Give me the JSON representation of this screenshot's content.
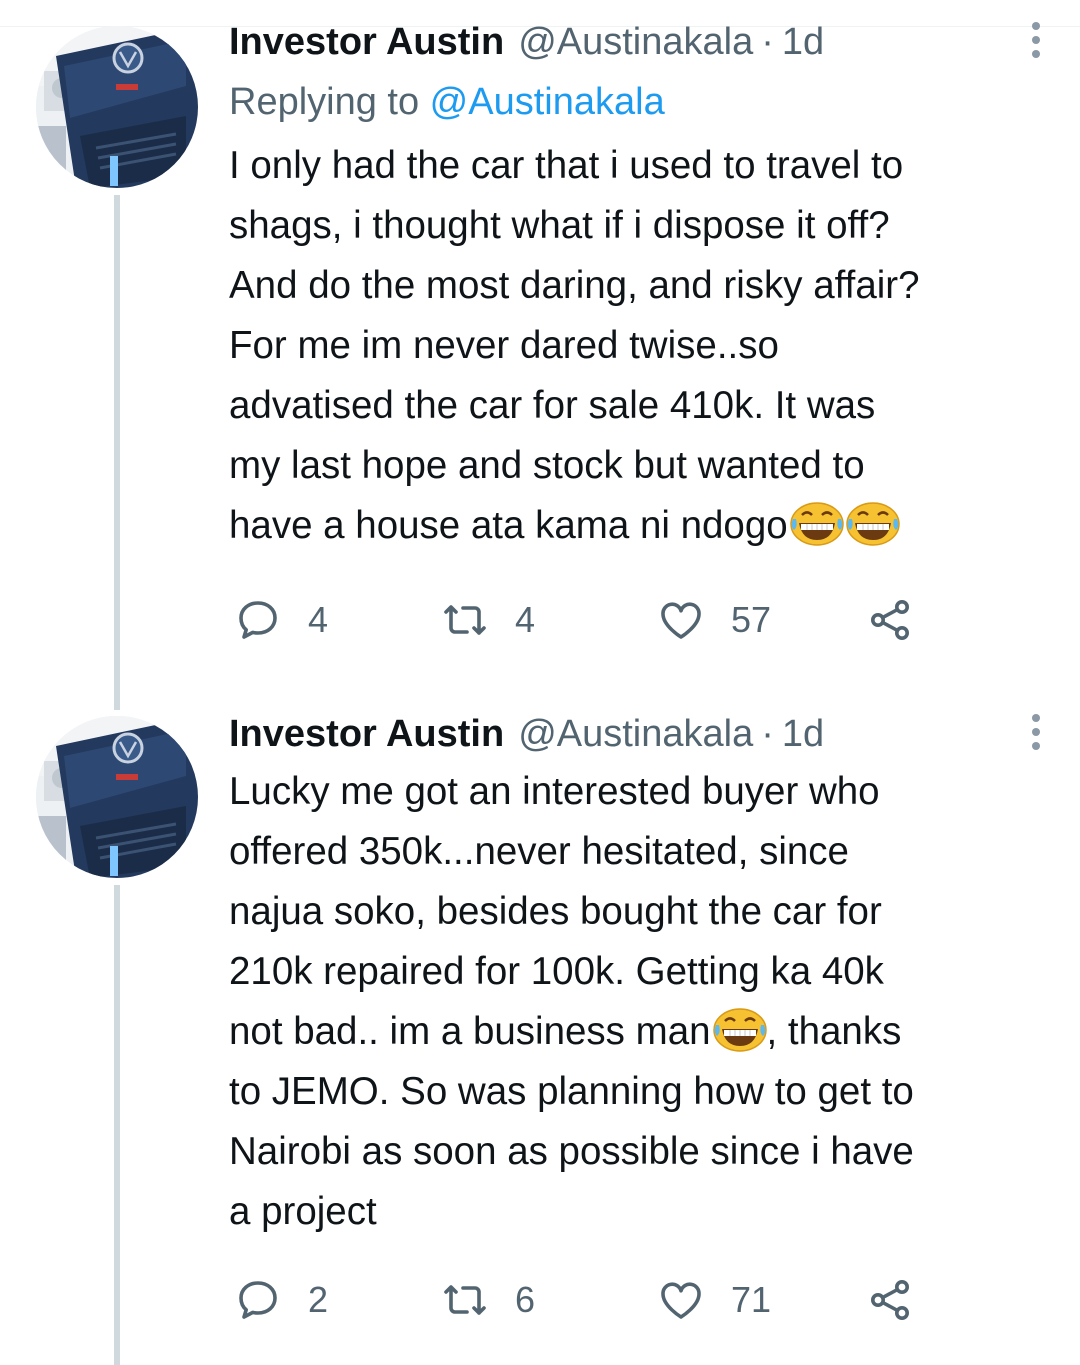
{
  "tweets": [
    {
      "author_name": "Investor Austin",
      "handle": "@Austinakala",
      "separator": "·",
      "time": "1d",
      "replying_prefix": "Replying to ",
      "replying_handle": "@Austinakala",
      "text_main": "I only had the car that i used to travel to\nshags, i thought what if i dispose it off?\nAnd do the most daring, and risky affair?\nFor me im never dared twise..so\nadvatised the car for sale 410k. It was\nmy last hope and stock but wanted to\nhave a house ata kama ni ndogo",
      "emojis": [
        "grinning-squinting-tears",
        "grinning-squinting-tears"
      ],
      "replies": "4",
      "retweets": "4",
      "likes": "57"
    },
    {
      "author_name": "Investor Austin",
      "handle": "@Austinakala",
      "separator": "·",
      "time": "1d",
      "text_a": "Lucky me got an interested buyer who\noffered 350k...never hesitated, since\nnajua soko, besides bought the car for\n210k repaired for 100k. Getting ka 40k\nnot bad.. im a business man",
      "text_b": ", thanks\nto JEMO. So was planning how to get to\nNairobi as soon as possible since i have\na project",
      "emoji": "grinning-squinting-tears",
      "replies": "2",
      "retweets": "6",
      "likes": "71"
    }
  ],
  "icons": {
    "reply": "reply-icon",
    "retweet": "retweet-icon",
    "like": "heart-icon",
    "share": "share-icon",
    "more": "more-vertical-icon"
  },
  "colors": {
    "link": "#1d9bf0",
    "secondary": "#536471",
    "thread_line": "#cfd9de"
  }
}
